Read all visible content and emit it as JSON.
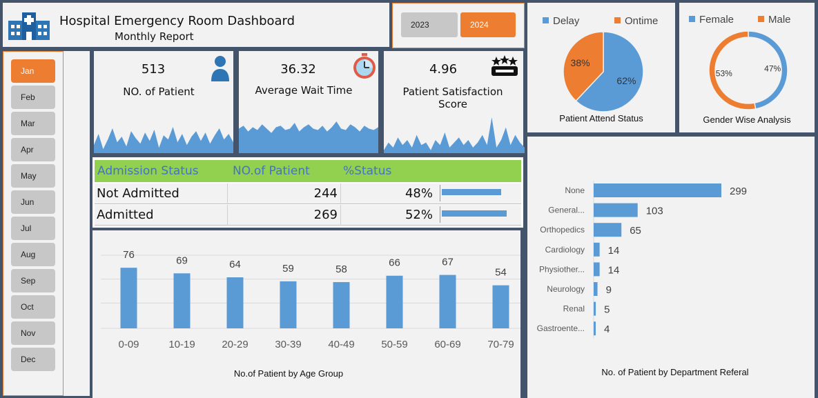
{
  "header": {
    "title": "Hospital Emergency Room Dashboard",
    "subtitle": "Monthly Report"
  },
  "years": [
    {
      "label": "2023",
      "selected": false
    },
    {
      "label": "2024",
      "selected": true
    }
  ],
  "months": [
    {
      "label": "Jan",
      "selected": true
    },
    {
      "label": "Feb",
      "selected": false
    },
    {
      "label": "Mar",
      "selected": false
    },
    {
      "label": "Apr",
      "selected": false
    },
    {
      "label": "May",
      "selected": false
    },
    {
      "label": "Jun",
      "selected": false
    },
    {
      "label": "Jul",
      "selected": false
    },
    {
      "label": "Aug",
      "selected": false
    },
    {
      "label": "Sep",
      "selected": false
    },
    {
      "label": "Oct",
      "selected": false
    },
    {
      "label": "Nov",
      "selected": false
    },
    {
      "label": "Dec",
      "selected": false
    }
  ],
  "kpis": {
    "patients": {
      "value": "513",
      "label": "NO. of Patient",
      "icon": "person-icon"
    },
    "wait_time": {
      "value": "36.32",
      "label": "Average Wait Time",
      "icon": "stopwatch-icon"
    },
    "satisfaction": {
      "value": "4.96",
      "label": "Patient Satisfaction Score",
      "icon": "stars-rating-icon"
    }
  },
  "admission_table": {
    "headers": [
      "Admission Status",
      "NO.of Patient",
      "%Status"
    ],
    "rows": [
      {
        "status": "Not Admitted",
        "patients": "244",
        "percent": "48%",
        "fraction": 0.48
      },
      {
        "status": "Admitted",
        "patients": "269",
        "percent": "52%",
        "fraction": 0.52
      }
    ]
  },
  "colors": {
    "accent": "#ed7d31",
    "blue": "#5b9bd5",
    "green_header": "#92d050",
    "frame": "#44546a"
  },
  "chart_data": [
    {
      "type": "area",
      "name": "patients-sparkline",
      "values": [
        10,
        18,
        7,
        14,
        22,
        12,
        16,
        9,
        20,
        15,
        11,
        19,
        13,
        21,
        8,
        17,
        14,
        23,
        12,
        18,
        10,
        16,
        20,
        13,
        19,
        11,
        17,
        22,
        14,
        18,
        12
      ]
    },
    {
      "type": "area",
      "name": "wait-time-sparkline",
      "values": [
        38,
        40,
        36,
        39,
        37,
        41,
        38,
        35,
        39,
        40,
        37,
        38,
        42,
        36,
        39,
        41,
        38,
        37,
        40,
        36,
        39,
        43,
        38,
        37,
        41,
        39,
        36,
        40,
        38,
        37,
        39
      ]
    },
    {
      "type": "area",
      "name": "satisfaction-sparkline",
      "values": [
        3,
        6,
        4,
        8,
        5,
        7,
        4,
        9,
        5,
        6,
        3,
        7,
        5,
        10,
        4,
        6,
        8,
        5,
        7,
        4,
        6,
        9,
        5,
        16,
        4,
        7,
        12,
        5,
        9,
        6,
        4
      ]
    },
    {
      "type": "pie",
      "title": "Patient Attend Status",
      "labels": [
        "Delay",
        "Ontime"
      ],
      "values": [
        62,
        38
      ],
      "value_labels": [
        "62%",
        "38%"
      ],
      "colors": [
        "#5b9bd5",
        "#ed7d31"
      ],
      "legend": "top"
    },
    {
      "type": "pie",
      "title": "Gender Wise Analysis",
      "labels": [
        "Female",
        "Male"
      ],
      "values": [
        47,
        53
      ],
      "value_labels": [
        "47%",
        "53%"
      ],
      "colors": [
        "#5b9bd5",
        "#ed7d31"
      ],
      "donut": true,
      "legend": "top"
    },
    {
      "type": "bar",
      "title": "No.of Patient by Age Group",
      "categories": [
        "0-09",
        "10-19",
        "20-29",
        "30-39",
        "40-49",
        "50-59",
        "60-69",
        "70-79"
      ],
      "values": [
        76,
        69,
        64,
        59,
        58,
        66,
        67,
        54
      ],
      "ylim": [
        0,
        90
      ],
      "grid": true
    },
    {
      "type": "bar",
      "orientation": "horizontal",
      "title": "No. of Patient by Department Referal",
      "categories": [
        "None",
        "General...",
        "Orthopedics",
        "Cardiology",
        "Physiother...",
        "Neurology",
        "Renal",
        "Gastroente..."
      ],
      "values": [
        299,
        103,
        65,
        14,
        14,
        9,
        5,
        4
      ]
    }
  ]
}
